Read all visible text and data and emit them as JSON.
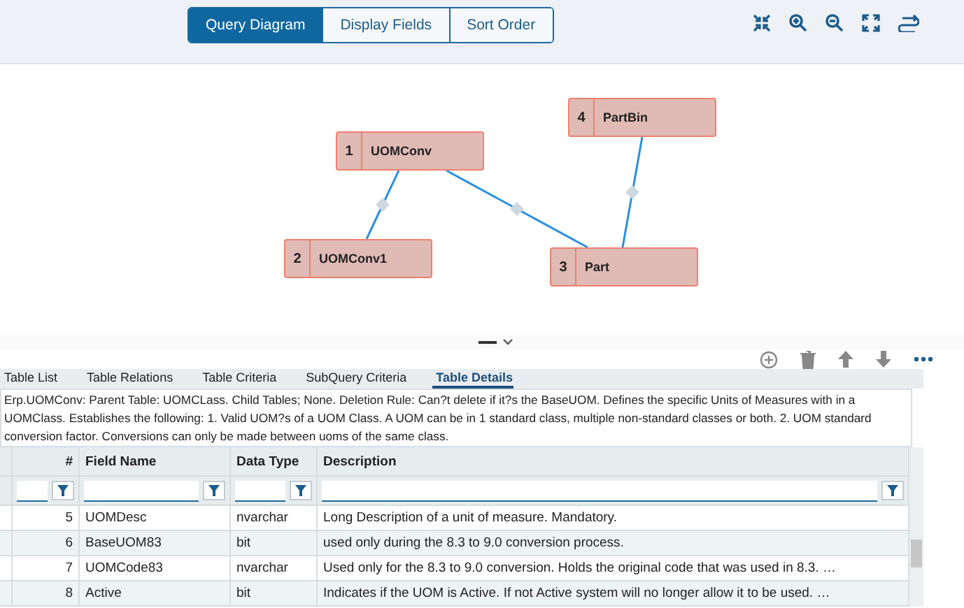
{
  "view_tabs": [
    {
      "label": "Query Diagram",
      "selected": true
    },
    {
      "label": "Display Fields",
      "selected": false
    },
    {
      "label": "Sort Order",
      "selected": false
    }
  ],
  "diagram": {
    "tables": [
      {
        "number": "1",
        "name": "UOMConv"
      },
      {
        "number": "2",
        "name": "UOMConv1"
      },
      {
        "number": "3",
        "name": "Part"
      },
      {
        "number": "4",
        "name": "PartBin"
      }
    ]
  },
  "detail_tabs": [
    {
      "label": "Table List",
      "selected": false
    },
    {
      "label": "Table Relations",
      "selected": false
    },
    {
      "label": "Table Criteria",
      "selected": false
    },
    {
      "label": "SubQuery Criteria",
      "selected": false
    },
    {
      "label": "Table Details",
      "selected": true
    }
  ],
  "table_description": "Erp.UOMConv: Parent Table: UOMCLass. Child Tables; None. Deletion Rule: Can?t delete if it?s the BaseUOM. Defines the specific Units of Measures with in a UOMClass. Establishes the following: 1. Valid UOM?s of a UOM Class. A UOM can be in 1 standard class, multiple non-standard classes or both. 2. UOM standard conversion factor. Conversions can only be made between uoms of the same class.",
  "grid": {
    "columns": [
      "#",
      "Field Name",
      "Data Type",
      "Description"
    ],
    "rows": [
      {
        "number": "5",
        "field_name": "UOMDesc",
        "data_type": "nvarchar",
        "description": "Long Description of a unit of measure. Mandatory."
      },
      {
        "number": "6",
        "field_name": "BaseUOM83",
        "data_type": "bit",
        "description": "used only during the 8.3 to 9.0 conversion process."
      },
      {
        "number": "7",
        "field_name": "UOMCode83",
        "data_type": "nvarchar",
        "description": "Used only for the 8.3 to 9.0 conversion. Holds the original code that was used in 8.3. …"
      },
      {
        "number": "8",
        "field_name": "Active",
        "data_type": "bit",
        "description": "Indicates if the UOM is Active. If not Active system will no longer allow it to be used. …"
      }
    ]
  }
}
